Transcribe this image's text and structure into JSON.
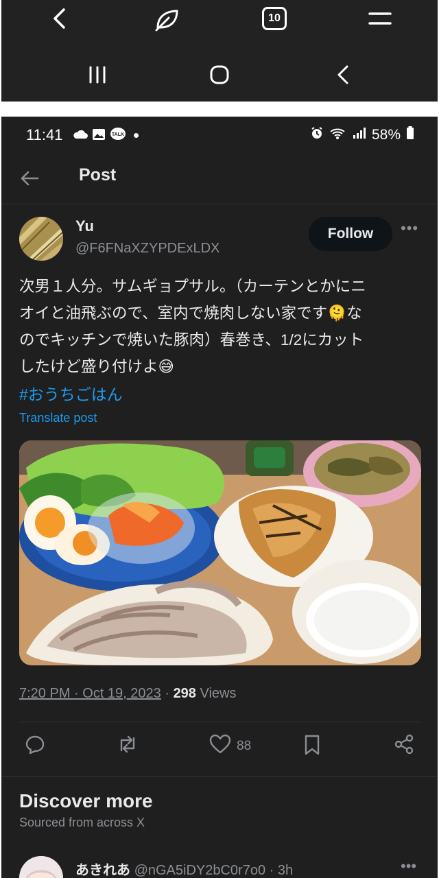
{
  "browser": {
    "tab_count": "10",
    "icons": [
      "back-chevron-icon",
      "leaf-icon",
      "tabs-icon",
      "menu-icon",
      "recents-icon",
      "home-icon",
      "back-icon"
    ]
  },
  "status_bar": {
    "time": "11:41",
    "battery": "58%"
  },
  "header": {
    "title": "Post"
  },
  "post": {
    "author_name": "Yu",
    "author_handle": "@F6FNaXZYPDExLDX",
    "follow_label": "Follow",
    "text_lines": [
      "次男１人分。サムギョプサル。（カーテンとかにニ",
      "オイと油飛ぶので、室内で焼肉しない家です🫠な",
      "のでキッチンで焼いた豚肉）春巻き、1/2にカット",
      "したけど盛り付けよ😅"
    ],
    "hashtag": "#おうちごはん",
    "translate_label": "Translate post",
    "timestamp": "7:20 PM · Oct 19, 2023",
    "views_count": "298",
    "views_label": "Views",
    "likes": "88"
  },
  "discover": {
    "title": "Discover more",
    "subtitle": "Sourced from across X",
    "next_post": {
      "name": "あきれあ",
      "handle": "@nGA5iDY2bC0r7o0",
      "time": "3h"
    }
  },
  "colors": {
    "background": "#1f1f1f",
    "accent_link": "#1d9bf0",
    "secondary_text": "#8b8f94"
  }
}
